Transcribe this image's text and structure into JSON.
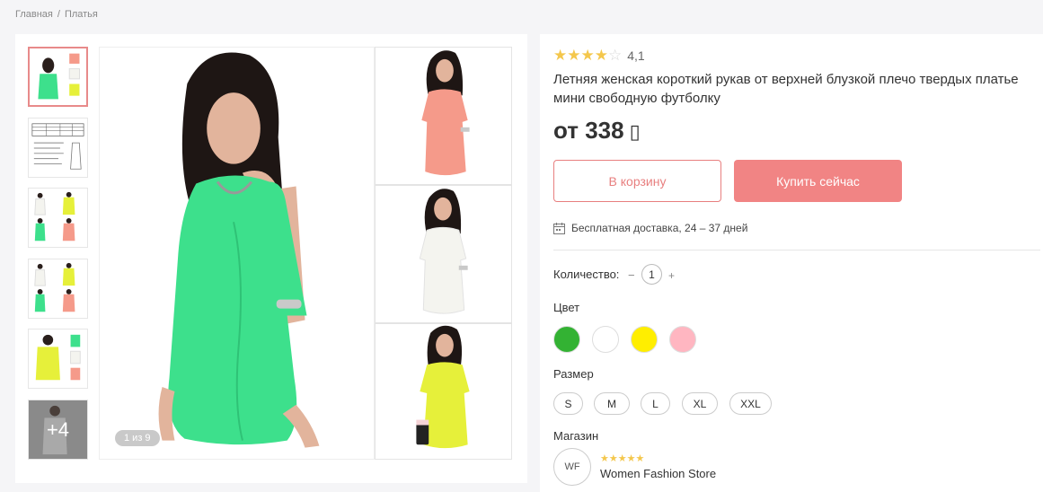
{
  "breadcrumb": {
    "home": "Главная",
    "separator": "/",
    "category": "Платья"
  },
  "product": {
    "rating_stars": "★★★★",
    "rating_empty": "☆",
    "rating_value": "4,1",
    "title": "Летняя женская короткий рукав от верхней блузкой плечо твердых платье мини свободную футболку",
    "price_prefix": "от",
    "price": "338",
    "currency_symbol": "▯"
  },
  "buttons": {
    "cart": "В корзину",
    "buy": "Купить сейчас"
  },
  "delivery": {
    "text": "Бесплатная доставка, 24 – 37 дней"
  },
  "quantity": {
    "label": "Количество:",
    "minus": "−",
    "value": "1",
    "plus": "+"
  },
  "color": {
    "label": "Цвет",
    "options": [
      "#33b233",
      "#ffffff",
      "#ffee00",
      "#ffb6c1"
    ]
  },
  "size": {
    "label": "Размер",
    "options": [
      "S",
      "M",
      "L",
      "XL",
      "XXL"
    ]
  },
  "shop": {
    "label": "Магазин",
    "logo": "WF",
    "stars": "★★★★★",
    "name": "Women Fashion Store"
  },
  "gallery": {
    "counter": "1 из 9",
    "more": "+4"
  },
  "colors": {
    "accent": "#f18484",
    "star": "#f4c74c",
    "dress_green": "#3de08c",
    "dress_pink": "#f59a8a",
    "dress_white": "#f4f4ef",
    "dress_yellow": "#e6f03a"
  }
}
